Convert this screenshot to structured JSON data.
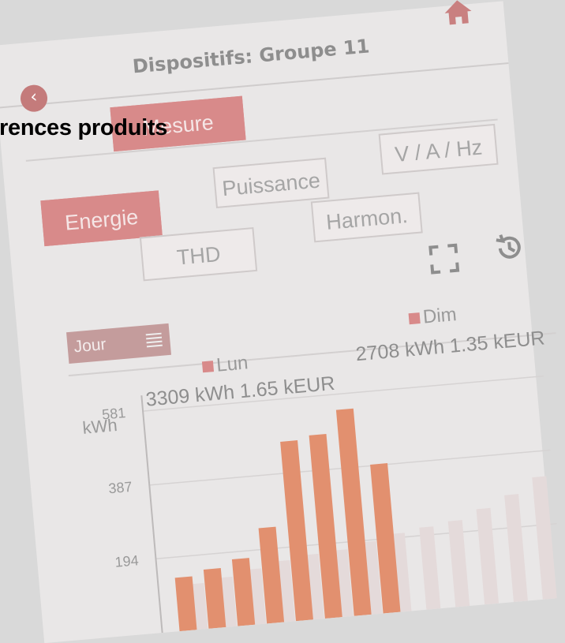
{
  "header": {
    "title": "Dispositifs: Groupe 11"
  },
  "tabs": {
    "mesure": "Mesure",
    "v_a_hz": "V / A / Hz",
    "puissance": "Puissance",
    "energie": "Energie",
    "harmon": "Harmon.",
    "thd": "THD"
  },
  "period": {
    "label": "Jour"
  },
  "overlay_heading": "rences produits",
  "icons": {
    "back": "chevron-left-icon",
    "home": "home-icon",
    "fullscreen": "fullscreen-icon",
    "history": "history-icon",
    "list": "list-icon"
  },
  "colors": {
    "accent": "#d88a8a",
    "bar_primary": "#e08a6e",
    "bar_secondary": "#eadede",
    "text_muted": "#8e8e8e"
  },
  "chart_data": {
    "type": "bar",
    "ylabel": "kWh",
    "y_ticks": [
      "581",
      "387",
      "194"
    ],
    "ylim": [
      0,
      581
    ],
    "legend": [
      {
        "name": "Lun",
        "summary": "3309 kWh 1.65 kEUR"
      },
      {
        "name": "Dim",
        "summary": "2708 kWh 1.35 kEUR"
      }
    ],
    "series": [
      {
        "name": "Lun",
        "values": [
          140,
          155,
          175,
          250,
          470,
          480,
          540,
          390
        ]
      },
      {
        "name": "Dim",
        "values": [
          120,
          130,
          145,
          160,
          170,
          175,
          190,
          205,
          215,
          225,
          250,
          280,
          320
        ]
      }
    ]
  }
}
